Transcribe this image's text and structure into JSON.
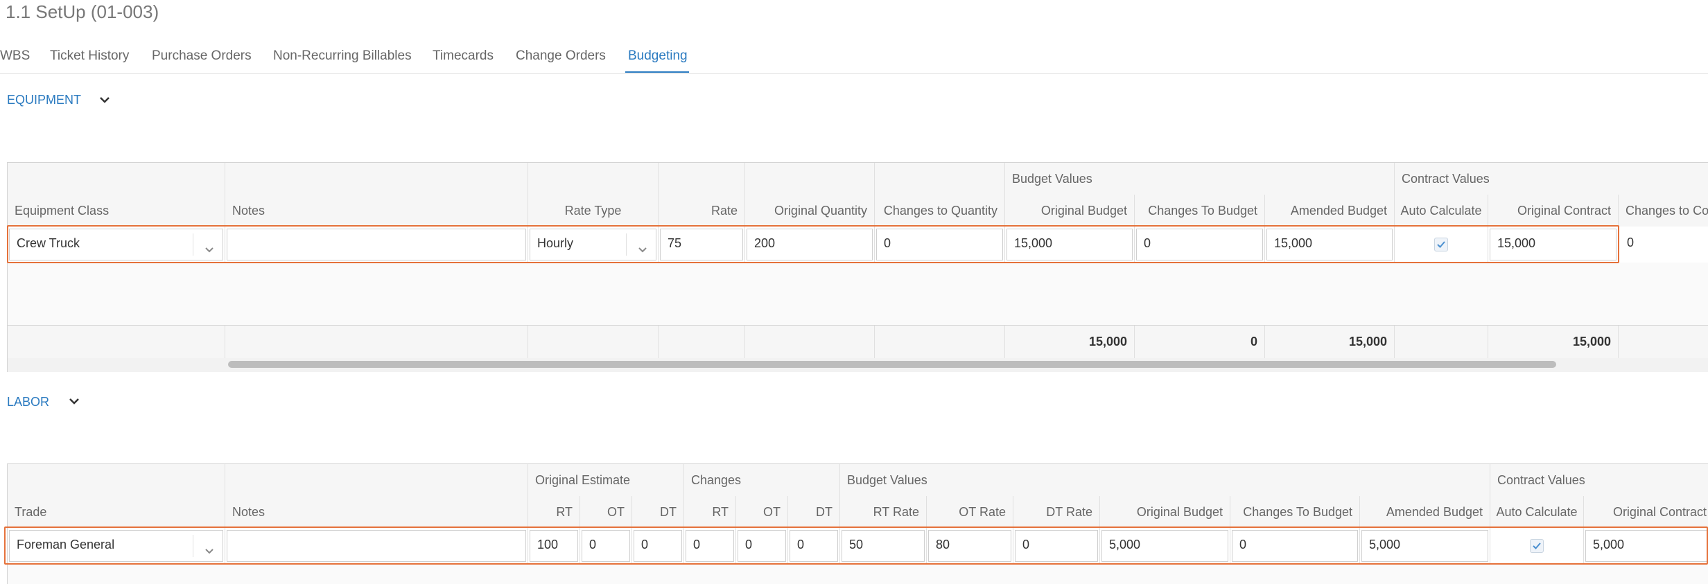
{
  "page": {
    "title": "1.1 SetUp (01-003)"
  },
  "tabs": [
    "WBS",
    "Ticket History",
    "Purchase Orders",
    "Non-Recurring Billables",
    "Timecards",
    "Change Orders",
    "Budgeting"
  ],
  "active_tab": "Budgeting",
  "equipment": {
    "section_label": "EQUIPMENT",
    "group_headers": {
      "budget_values": "Budget Values",
      "contract_values": "Contract Values"
    },
    "columns": {
      "equipment_class": "Equipment Class",
      "notes": "Notes",
      "rate_type": "Rate Type",
      "rate": "Rate",
      "original_quantity": "Original Quantity",
      "changes_to_quantity": "Changes to Quantity",
      "original_budget": "Original Budget",
      "changes_to_budget": "Changes To Budget",
      "amended_budget": "Amended Budget",
      "auto_calculate": "Auto Calculate",
      "original_contract": "Original Contract",
      "changes_to_contract": "Changes to Co"
    },
    "row": {
      "equipment_class": "Crew Truck",
      "notes": "",
      "rate_type": "Hourly",
      "rate": "75",
      "original_quantity": "200",
      "changes_to_quantity": "0",
      "original_budget": "15,000",
      "changes_to_budget": "0",
      "amended_budget": "15,000",
      "auto_calculate": true,
      "original_contract": "15,000",
      "changes_to_contract": "0"
    },
    "totals": {
      "original_budget": "15,000",
      "changes_to_budget": "0",
      "amended_budget": "15,000",
      "original_contract": "15,000"
    }
  },
  "labor": {
    "section_label": "LABOR",
    "group_headers": {
      "original_estimate": "Original Estimate",
      "changes": "Changes",
      "budget_values": "Budget Values",
      "contract_values": "Contract Values"
    },
    "columns": {
      "trade": "Trade",
      "notes": "Notes",
      "oe_rt": "RT",
      "oe_ot": "OT",
      "oe_dt": "DT",
      "ch_rt": "RT",
      "ch_ot": "OT",
      "ch_dt": "DT",
      "rt_rate": "RT Rate",
      "ot_rate": "OT Rate",
      "dt_rate": "DT Rate",
      "original_budget": "Original Budget",
      "changes_to_budget": "Changes To Budget",
      "amended_budget": "Amended Budget",
      "auto_calculate": "Auto Calculate",
      "original_contract": "Original Contract"
    },
    "row": {
      "trade": "Foreman General",
      "notes": "",
      "oe_rt": "100",
      "oe_ot": "0",
      "oe_dt": "0",
      "ch_rt": "0",
      "ch_ot": "0",
      "ch_dt": "0",
      "rt_rate": "50",
      "ot_rate": "80",
      "dt_rate": "0",
      "original_budget": "5,000",
      "changes_to_budget": "0",
      "amended_budget": "5,000",
      "auto_calculate": true,
      "original_contract": "5,000"
    }
  },
  "colors": {
    "accent": "#2a7ac0",
    "highlight": "#e5713a"
  }
}
